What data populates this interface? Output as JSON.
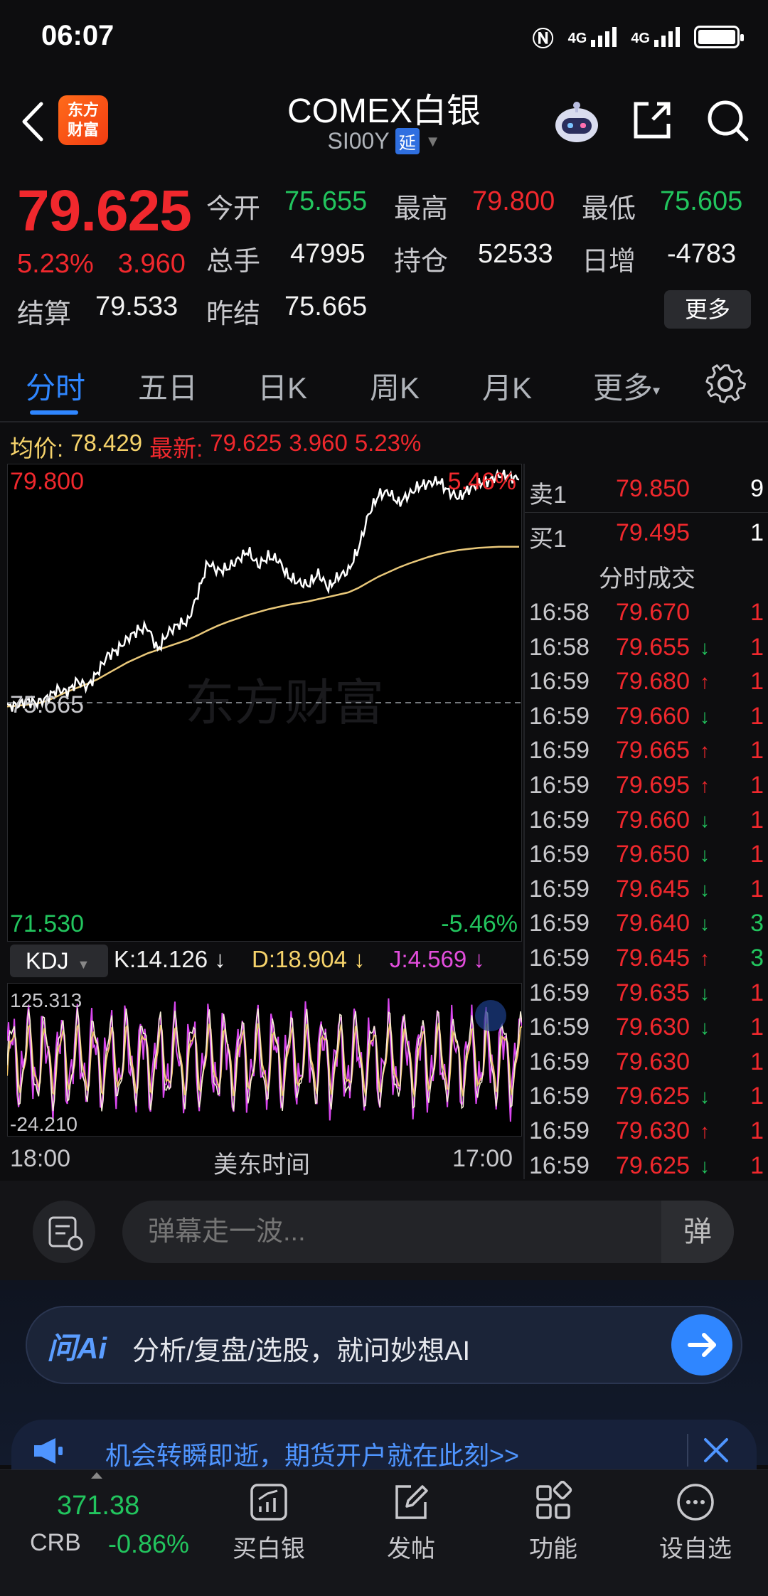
{
  "status_bar": {
    "time": "06:07",
    "signal1": "4G",
    "signal2": "4G"
  },
  "header": {
    "brand": "东方\n财富",
    "brand_line1": "东方",
    "brand_line2": "财富",
    "title": "COMEX白银",
    "symbol": "SI00Y",
    "delay_badge": "延"
  },
  "quote": {
    "last_price": "79.625",
    "change_pct": "5.23%",
    "change_abs": "3.960",
    "open_label": "今开",
    "open": "75.655",
    "high_label": "最高",
    "high": "79.800",
    "low_label": "最低",
    "low": "75.605",
    "volume_label": "总手",
    "volume": "47995",
    "oi_label": "持仓",
    "oi": "52533",
    "daily_inc_label": "日增",
    "daily_inc": "-4783",
    "settle_label": "结算",
    "settle": "79.533",
    "prev_settle_label": "昨结",
    "prev_settle": "75.665",
    "more_label": "更多"
  },
  "tabs": [
    {
      "label": "分时",
      "active": true
    },
    {
      "label": "五日",
      "active": false
    },
    {
      "label": "日K",
      "active": false
    },
    {
      "label": "周K",
      "active": false
    },
    {
      "label": "月K",
      "active": false
    },
    {
      "label": "更多",
      "active": false
    }
  ],
  "chart_header": {
    "avg_label": "均价:",
    "avg_value": "78.429",
    "latest_label": "最新:",
    "latest_value": "79.625",
    "latest_change": "3.960",
    "latest_pct": "5.23%"
  },
  "chart_data": {
    "type": "line",
    "title": "",
    "y_top_label": "79.800",
    "y_prev_label": "75.665",
    "y_bottom_label": "71.530",
    "pct_top_label": "5.46%",
    "pct_bottom_label": "-5.46%",
    "x_start_label": "18:00",
    "x_mid_label": "美东时间",
    "x_end_label": "17:00",
    "ylim": [
      71.53,
      79.8
    ],
    "prev_settle": 75.665,
    "series": [
      {
        "values": [
          75.6,
          75.62,
          75.7,
          75.66,
          75.75,
          75.9,
          75.85,
          76.05,
          75.95,
          76.2,
          76.5,
          76.6,
          76.8,
          76.95,
          77.0,
          76.6,
          76.9,
          77.05,
          77.1,
          77.6,
          78.15,
          78.0,
          78.05,
          78.2,
          78.35,
          78.1,
          78.25,
          78.2,
          77.9,
          77.8,
          77.75,
          77.95,
          77.7,
          77.9,
          78.0,
          78.4,
          79.0,
          79.35,
          79.4,
          79.2,
          79.35,
          79.5,
          79.55,
          79.6,
          79.4,
          79.3,
          79.45,
          79.55,
          79.6,
          79.7,
          79.68,
          79.62
        ]
      },
      {
        "values": [
          75.6,
          75.61,
          75.63,
          75.65,
          75.7,
          75.78,
          75.86,
          75.93,
          76.0,
          76.08,
          76.18,
          76.28,
          76.38,
          76.46,
          76.54,
          76.6,
          76.66,
          76.72,
          76.78,
          76.86,
          76.95,
          77.03,
          77.1,
          77.16,
          77.22,
          77.27,
          77.32,
          77.36,
          77.4,
          77.43,
          77.46,
          77.5,
          77.54,
          77.58,
          77.62,
          77.7,
          77.8,
          77.9,
          77.98,
          78.06,
          78.13,
          78.19,
          78.25,
          78.3,
          78.34,
          78.37,
          78.39,
          78.41,
          78.42,
          78.43,
          78.43,
          78.43
        ]
      }
    ]
  },
  "kdj": {
    "selector": "KDJ",
    "k": "K:14.126",
    "d": "D:18.904",
    "j": "J:4.569",
    "top_label": "125.313",
    "bottom_label": "-24.210"
  },
  "order_book": {
    "ask": {
      "label": "卖1",
      "price": "79.850",
      "qty": "9"
    },
    "bid": {
      "label": "买1",
      "price": "79.495",
      "qty": "1"
    },
    "trades_title": "分时成交",
    "trades": [
      {
        "time": "16:58",
        "price": "79.670",
        "dir": "",
        "qty": "1"
      },
      {
        "time": "16:58",
        "price": "79.655",
        "dir": "↓",
        "qty": "1"
      },
      {
        "time": "16:59",
        "price": "79.680",
        "dir": "↑",
        "qty": "1"
      },
      {
        "time": "16:59",
        "price": "79.660",
        "dir": "↓",
        "qty": "1"
      },
      {
        "time": "16:59",
        "price": "79.665",
        "dir": "↑",
        "qty": "1"
      },
      {
        "time": "16:59",
        "price": "79.695",
        "dir": "↑",
        "qty": "1"
      },
      {
        "time": "16:59",
        "price": "79.660",
        "dir": "↓",
        "qty": "1"
      },
      {
        "time": "16:59",
        "price": "79.650",
        "dir": "↓",
        "qty": "1"
      },
      {
        "time": "16:59",
        "price": "79.645",
        "dir": "↓",
        "qty": "1"
      },
      {
        "time": "16:59",
        "price": "79.640",
        "dir": "↓",
        "qty": "3"
      },
      {
        "time": "16:59",
        "price": "79.645",
        "dir": "↑",
        "qty": "3"
      },
      {
        "time": "16:59",
        "price": "79.635",
        "dir": "↓",
        "qty": "1"
      },
      {
        "time": "16:59",
        "price": "79.630",
        "dir": "↓",
        "qty": "1"
      },
      {
        "time": "16:59",
        "price": "79.630",
        "dir": "",
        "qty": "1"
      },
      {
        "time": "16:59",
        "price": "79.625",
        "dir": "↓",
        "qty": "1"
      },
      {
        "time": "16:59",
        "price": "79.630",
        "dir": "↑",
        "qty": "1"
      },
      {
        "time": "16:59",
        "price": "79.625",
        "dir": "↓",
        "qty": "1"
      }
    ]
  },
  "danmaku": {
    "placeholder": "弹幕走一波...",
    "toggle": "弹"
  },
  "ai": {
    "logo": "问Ai",
    "text": "分析/复盘/选股，就问妙想AI"
  },
  "promo": {
    "text": "机会转瞬即逝，期货开户就在此刻>>"
  },
  "bottom_nav": {
    "crb_value": "371.38",
    "crb_label": "CRB",
    "crb_change": "-0.86%",
    "items": [
      {
        "label": "买白银",
        "icon": "chart-bar-icon"
      },
      {
        "label": "发帖",
        "icon": "edit-icon"
      },
      {
        "label": "功能",
        "icon": "grid-icon"
      },
      {
        "label": "设自选",
        "icon": "more-circle-icon"
      }
    ]
  },
  "colors": {
    "up": "#f0282d",
    "down": "#22c55e",
    "accent": "#2f86ff",
    "avg_line": "#e9c87a",
    "k_line": "#f0c46a",
    "j_line": "#d946ef"
  }
}
